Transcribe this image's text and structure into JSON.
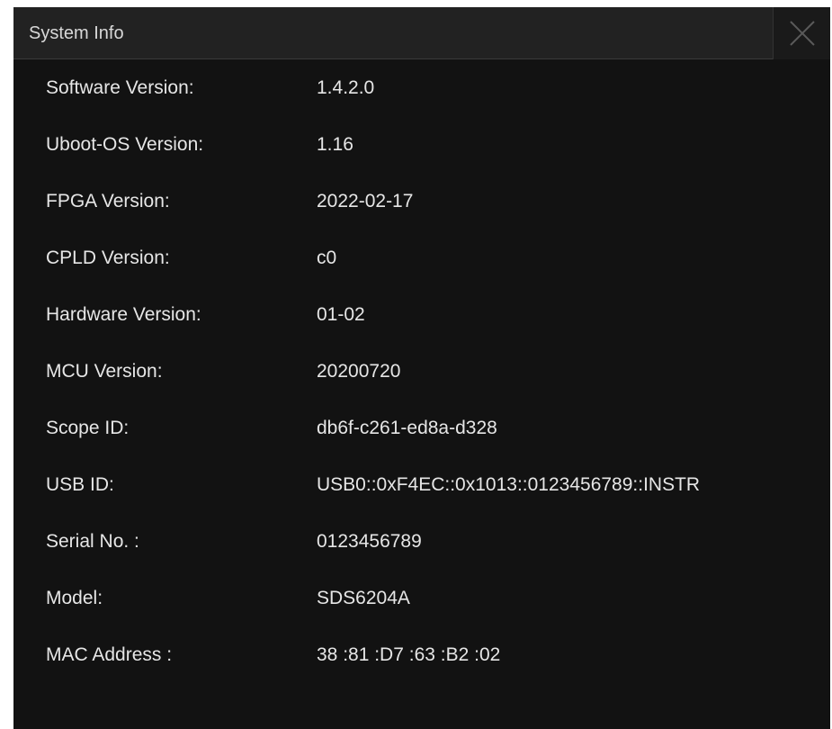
{
  "dialog": {
    "title": "System Info",
    "close_icon": "close-icon",
    "colors": {
      "background": "#121212",
      "title_bar": "#222222",
      "text": "#e6e6e6"
    }
  },
  "info": [
    {
      "label": "Software Version:",
      "value": "1.4.2.0"
    },
    {
      "label": "Uboot-OS Version:",
      "value": "1.16"
    },
    {
      "label": "FPGA Version:",
      "value": "2022-02-17"
    },
    {
      "label": "CPLD Version:",
      "value": "c0"
    },
    {
      "label": "Hardware Version:",
      "value": "01-02"
    },
    {
      "label": "MCU Version:",
      "value": "20200720"
    },
    {
      "label": "Scope ID:",
      "value": "db6f-c261-ed8a-d328"
    },
    {
      "label": "USB ID:",
      "value": "USB0::0xF4EC::0x1013::0123456789::INSTR"
    },
    {
      "label": "Serial No. :",
      "value": "0123456789"
    },
    {
      "label": "Model:",
      "value": "SDS6204A"
    },
    {
      "label": "MAC Address :",
      "value": "38 :81 :D7 :63 :B2 :02"
    }
  ]
}
